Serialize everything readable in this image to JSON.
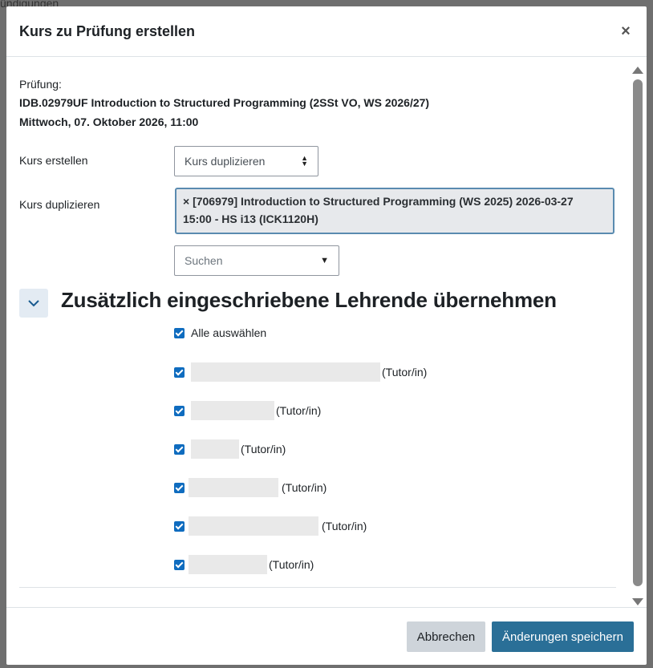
{
  "background": {
    "fragment_top": "ündigungen"
  },
  "modal": {
    "title": "Kurs zu Prüfung erstellen",
    "close_glyph": "×"
  },
  "exam": {
    "label": "Prüfung:",
    "title": "IDB.02979UF Introduction to Structured Programming (2SSt VO, WS 2026/27)",
    "date": "Mittwoch, 07. Oktober 2026, 11:00"
  },
  "create_course": {
    "label": "Kurs erstellen",
    "selected": "Kurs duplizieren"
  },
  "duplicate_course": {
    "label": "Kurs duplizieren",
    "selected_tag_line1": "× [706979] Introduction to Structured Programming (WS 2025) 2026-03-27",
    "selected_tag_line2": "15:00 - HS i13 (ICK1120H)",
    "search_placeholder": "Suchen",
    "search_caret": "▼"
  },
  "teachers_section": {
    "toggle_icon": "chevron-down-icon",
    "heading": "Zusätzlich eingeschriebene Lehrende übernehmen",
    "select_all_label": "Alle auswählen",
    "items": [
      {
        "role": "(Tutor/in)",
        "checked": true
      },
      {
        "role": "(Tutor/in)",
        "checked": true
      },
      {
        "role": "(Tutor/in)",
        "checked": true
      },
      {
        "role": "(Tutor/in)",
        "checked": true
      },
      {
        "role": "(Tutor/in)",
        "checked": true
      },
      {
        "role": "(Tutor/in)",
        "checked": true
      }
    ]
  },
  "footer": {
    "cancel_label": "Abbrechen",
    "save_label": "Änderungen speichern"
  },
  "colors": {
    "primary": "#2a6f97",
    "checkbox": "#0f6cbf",
    "cancel_bg": "#ced4da"
  }
}
